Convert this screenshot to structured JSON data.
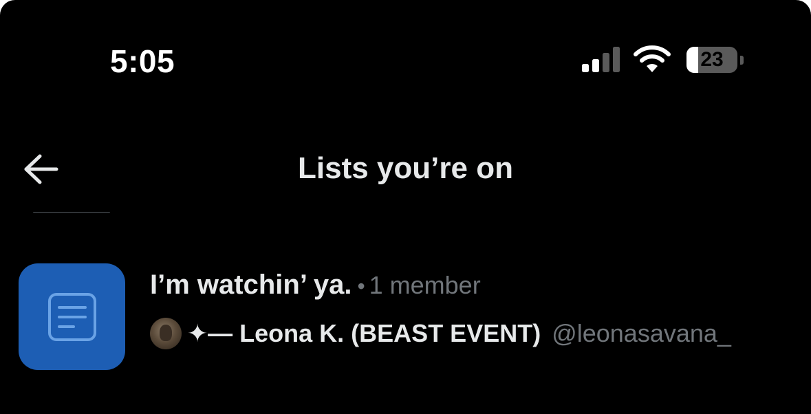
{
  "status_bar": {
    "time": "5:05",
    "battery_level": "23",
    "battery_fraction": 0.23,
    "signal_bars_active": 2,
    "signal_bars_total": 4
  },
  "header": {
    "title": "Lists you’re on",
    "back_icon": "arrow-left-icon"
  },
  "lists": [
    {
      "name": "I’m watchin’ ya.",
      "separator": "•",
      "member_count": "1 member",
      "thumbnail_icon": "list-document-icon",
      "thumbnail_color": "#1d5eb4",
      "owner": {
        "display_name": "✦— Leona K. (BEAST EVENT)",
        "handle": "@leonasavana_"
      }
    }
  ],
  "colors": {
    "background": "#000000",
    "primary_text": "#e7e9ea",
    "secondary_text": "#71767b"
  }
}
